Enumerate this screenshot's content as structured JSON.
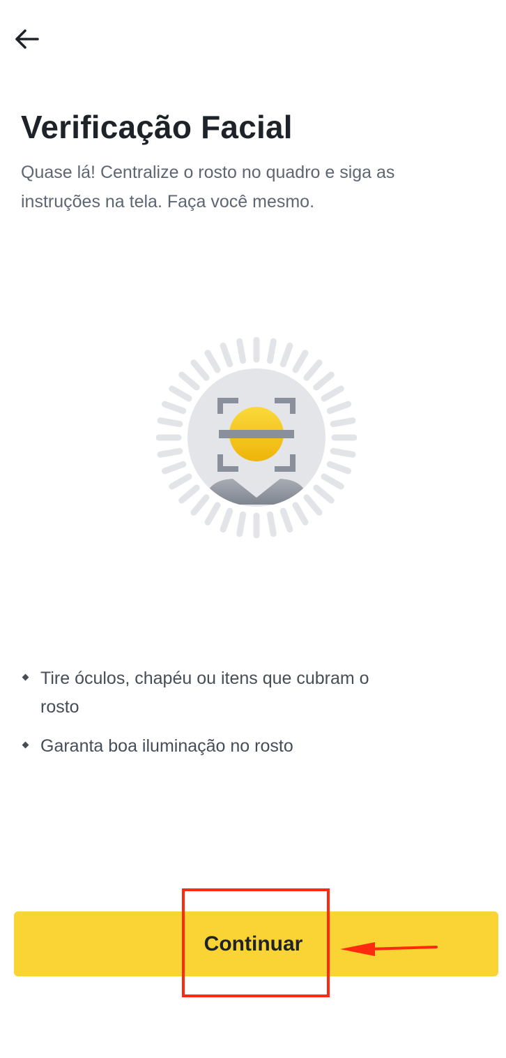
{
  "header": {
    "back_icon": "arrow-left-icon"
  },
  "page": {
    "title": "Verificação Facial",
    "subtitle": "Quase lá! Centralize o rosto no quadro e siga as instruções na tela. Faça você mesmo."
  },
  "illustration": {
    "icon": "face-scan-icon"
  },
  "tips": [
    {
      "text": "Tire óculos, chapéu ou itens que cubram o rosto"
    },
    {
      "text": "Garanta boa iluminação no rosto"
    }
  ],
  "actions": {
    "continue_label": "Continuar"
  },
  "annotation": {
    "color": "#ff2a0e",
    "arrow_icon": "arrow-left-annotation-icon"
  },
  "colors": {
    "accent": "#fad434",
    "text_primary": "#1e2329",
    "text_secondary": "#5e6673"
  }
}
